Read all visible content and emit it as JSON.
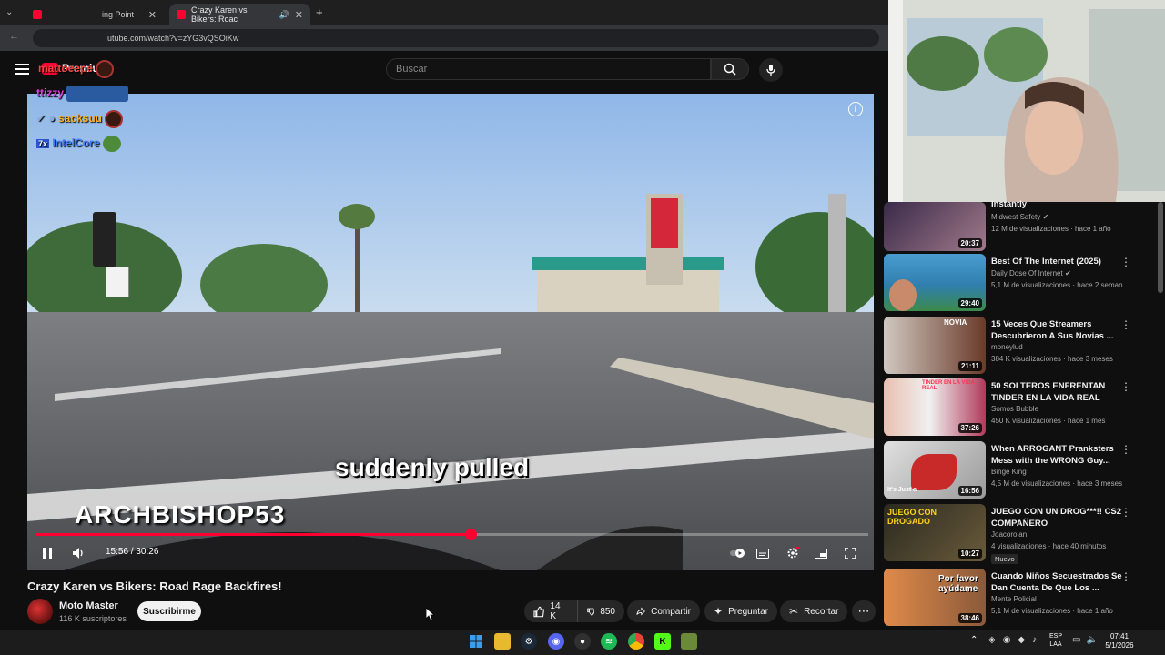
{
  "browser": {
    "tabs": [
      {
        "label": "ing Point -",
        "active": false
      },
      {
        "label": "Crazy Karen vs Bikers: Roac",
        "active": true
      }
    ],
    "new_tab_label": "+",
    "url": "utube.com/watch?v=zYG3vQSOiKw"
  },
  "youtube": {
    "premium_label": "Premium",
    "search_placeholder": "Buscar"
  },
  "player": {
    "subtitle": "suddenly pulled",
    "watermark": "ARCHBISHOP53",
    "time_display": "15:56 / 30:26",
    "progress_fraction": 0.523
  },
  "video": {
    "title": "Crazy Karen vs Bikers: Road Rage Backfires!",
    "channel": "Moto Master",
    "subscribers": "116 K suscriptores",
    "subscribe_label": "Suscribirme",
    "likes": "14 K",
    "dislikes": "850",
    "share_label": "Compartir",
    "ask_label": "Preguntar",
    "clip_label": "Recortar",
    "more_label": "⋯"
  },
  "chat_overlay": [
    {
      "name": "mattoeepe",
      "color": "#ff4040"
    },
    {
      "name": "ttizzy",
      "color": "#e040e0"
    },
    {
      "name": "sacksuu",
      "color": "#ffb020"
    },
    {
      "name": "IntelCore",
      "color": "#4080ff"
    }
  ],
  "recommendations": [
    {
      "title": "Instantly",
      "channel": "Midwest Safety",
      "verified": true,
      "meta": "12 M de visualizaciones · hace 1 año",
      "duration": "20:37",
      "thumb_color": "#7a5a8a"
    },
    {
      "title": "Best Of The Internet (2025)",
      "channel": "Daily Dose Of Internet",
      "verified": true,
      "meta": "5,1 M de visualizaciones · hace 2 seman...",
      "duration": "29:40",
      "thumb_color": "#2f7fae"
    },
    {
      "title": "15 Veces Que Streamers Descubrieron A Sus Novias ...",
      "channel": "moneylud",
      "verified": false,
      "meta": "384 K visualizaciones · hace 3 meses",
      "duration": "21:11",
      "thumb_color": "#8a5a4a"
    },
    {
      "title": "50 SOLTEROS ENFRENTAN TINDER EN LA VIDA REAL",
      "channel": "Somos Bubble",
      "verified": false,
      "meta": "450 K visualizaciones · hace 1 mes",
      "duration": "37:26",
      "thumb_color": "#b03a5a"
    },
    {
      "title": "When ARROGANT Pranksters Mess with the WRONG Guy...",
      "channel": "Binge King",
      "verified": false,
      "meta": "4,5 M de visualizaciones · hace 3 meses",
      "duration": "16:56",
      "thumb_color": "#c0c0c0"
    },
    {
      "title": "JUEGO CON UN DROG***!! CS2 COMPAÑERO",
      "channel": "Joacorolan",
      "verified": false,
      "meta": "4 visualizaciones · hace 40 minutos",
      "duration": "10:27",
      "badge": "Nuevo",
      "thumb_color": "#3a3a2a"
    },
    {
      "title": "Cuando Niños Secuestrados Se Dan Cuenta De Que Los ...",
      "channel": "Mente Policial",
      "verified": false,
      "meta": "5,1 M de visualizaciones · hace 1 año",
      "duration": "38:46",
      "thumb_color": "#d07030"
    }
  ],
  "overlay_texts": {
    "thumb4": "TINDER EN LA VIDA REAL",
    "thumb5": "It's Just a",
    "thumb6": "JUEGO CON DROGADO",
    "thumb7": "Por favor ayúdame",
    "thumb3": "NOVIA"
  },
  "taskbar": {
    "lang_line1": "ESP",
    "lang_line2": "LAA",
    "time": "07:41",
    "date": "5/1/2026"
  },
  "colors": {
    "accent": "#ff0033",
    "background": "#0f0f0f"
  }
}
